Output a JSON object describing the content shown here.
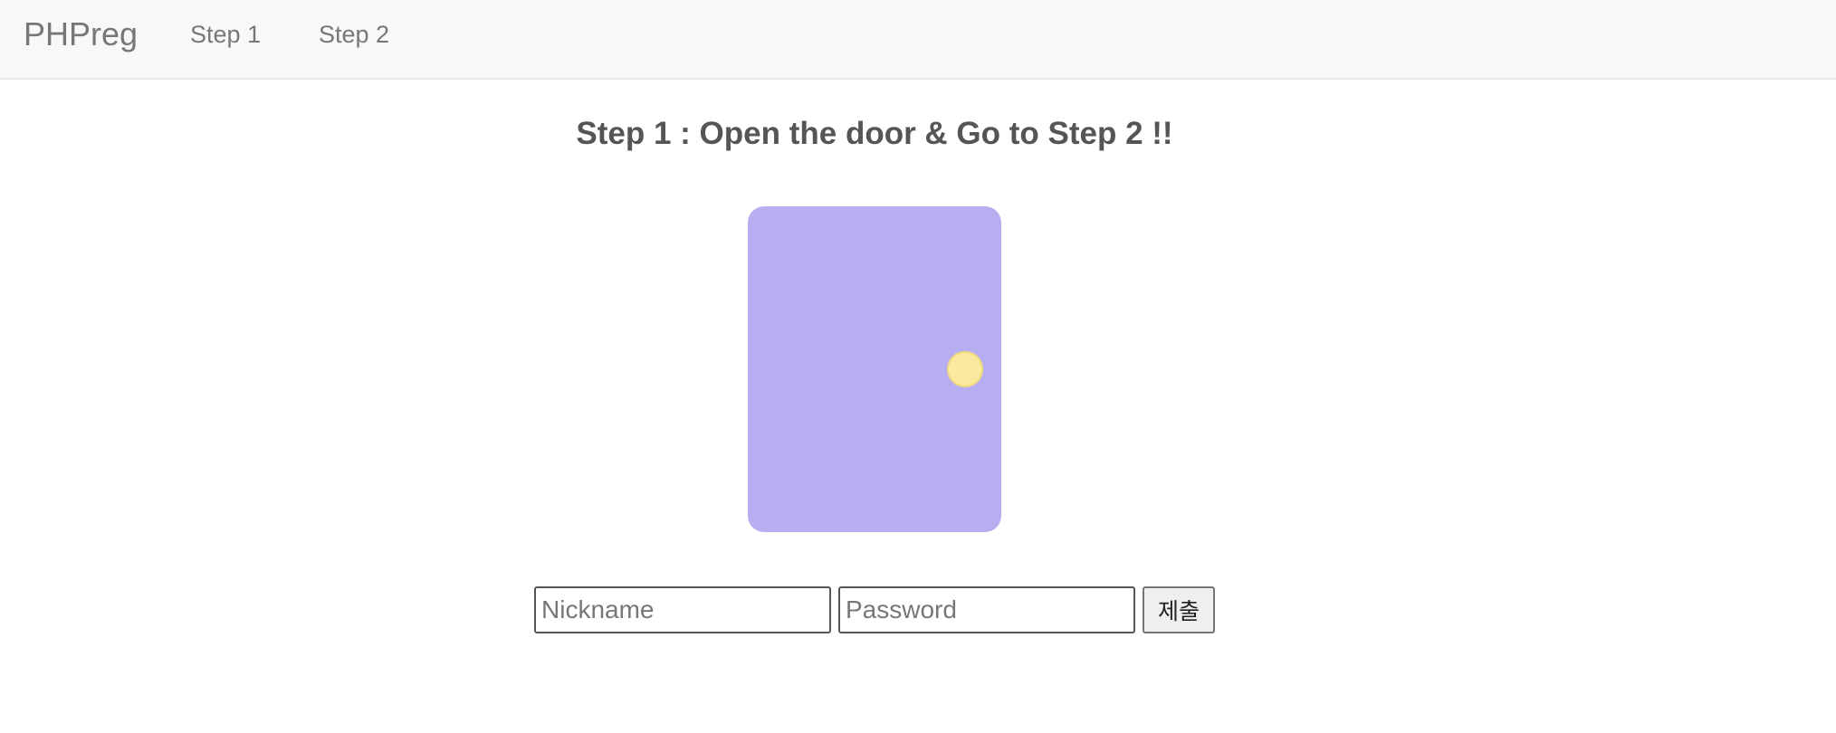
{
  "navbar": {
    "brand": "PHPreg",
    "links": [
      {
        "label": "Step 1"
      },
      {
        "label": "Step 2"
      }
    ]
  },
  "main": {
    "title": "Step 1 : Open the door & Go to Step 2 !!",
    "door": {
      "color": "#b7aef1",
      "knob_color": "#fce9a0"
    }
  },
  "form": {
    "nickname": {
      "placeholder": "Nickname",
      "value": ""
    },
    "password": {
      "placeholder": "Password",
      "value": ""
    },
    "submit_label": "제출"
  }
}
